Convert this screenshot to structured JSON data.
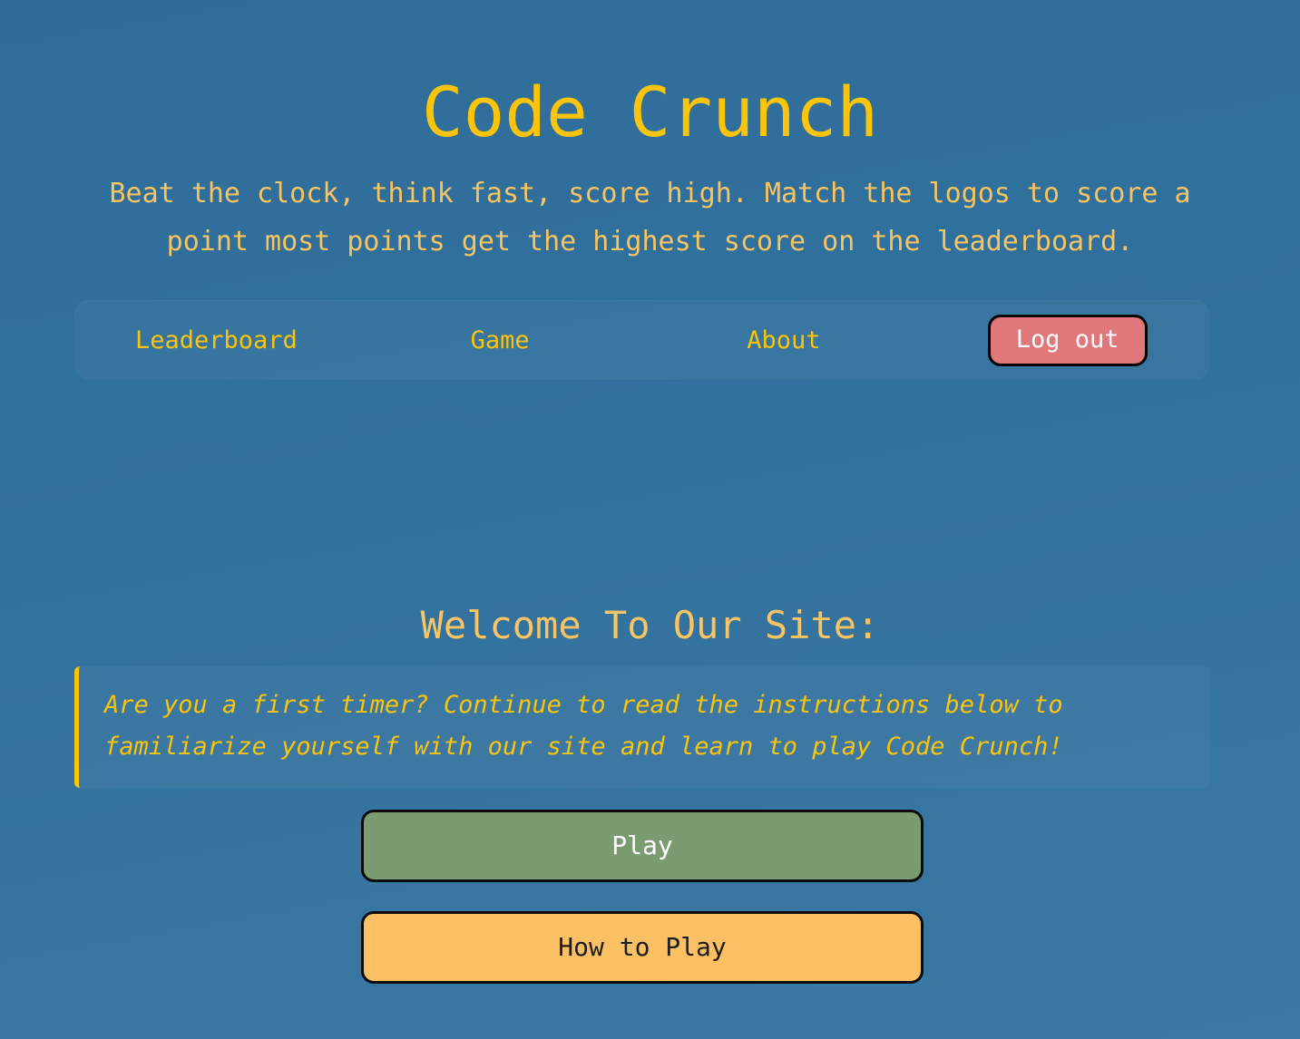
{
  "site": {
    "title": "Code Crunch",
    "tagline": "Beat the clock, think fast, score high. Match the logos to score a point most points get the highest score on the leaderboard."
  },
  "nav": {
    "items": [
      {
        "label": "Leaderboard",
        "name": "nav-link-leaderboard"
      },
      {
        "label": "Game",
        "name": "nav-link-game"
      },
      {
        "label": "About",
        "name": "nav-link-about"
      }
    ],
    "logout_label": "Log out"
  },
  "main": {
    "welcome_heading": "Welcome To Our Site:",
    "intro_quote": "Are you a first timer? Continue to read the instructions below to familiarize yourself with our site and learn to play Code Crunch!",
    "play_label": "Play",
    "how_to_play_label": "How to Play"
  },
  "colors": {
    "background": "#31719e",
    "brand_gold": "#fac40a",
    "soft_amber": "#f8c45f",
    "logout_red": "#e0777a",
    "play_green": "#7b9b71",
    "howto_amber": "#fbc063",
    "button_border": "#0a0a0a",
    "text_white": "#ffffff"
  }
}
